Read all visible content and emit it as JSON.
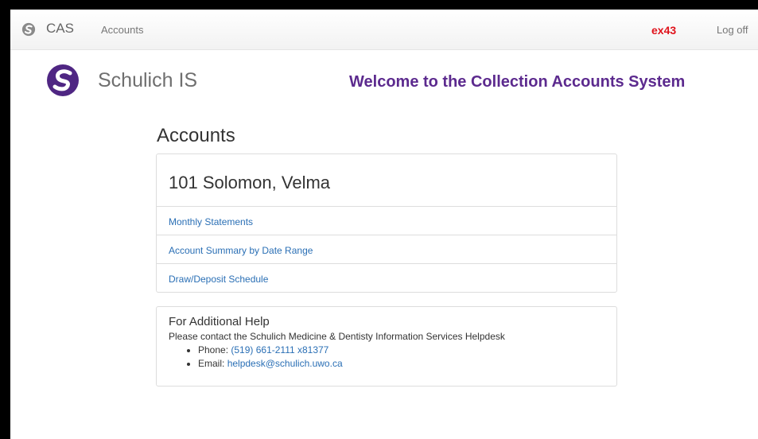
{
  "navbar": {
    "brand": "CAS",
    "link_accounts": "Accounts",
    "user": "ex43",
    "logoff": "Log off"
  },
  "header": {
    "brand": "Schulich IS",
    "welcome": "Welcome to the Collection Accounts System"
  },
  "page": {
    "title": "Accounts"
  },
  "account": {
    "name": "101 Solomon, Velma",
    "links": [
      "Monthly Statements",
      "Account Summary by Date Range",
      "Draw/Deposit Schedule"
    ]
  },
  "help": {
    "title": "For Additional Help",
    "text": "Please contact the Schulich Medicine & Dentisty Information Services Helpdesk",
    "phone_label": "Phone: ",
    "phone_value": "(519) 661-2111 x81377",
    "email_label": "Email: ",
    "email_value": "helpdesk@schulich.uwo.ca"
  },
  "colors": {
    "brand_purple": "#5c2a8e",
    "user_red": "#e0121b",
    "link_blue": "#2a6fb5"
  }
}
